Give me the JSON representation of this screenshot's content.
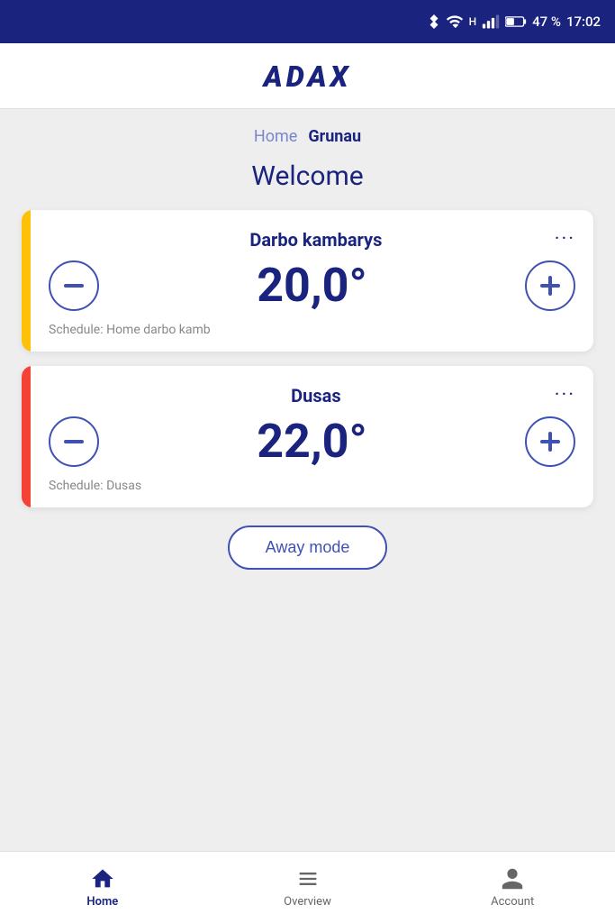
{
  "statusBar": {
    "battery": "47 %",
    "time": "17:02"
  },
  "header": {
    "logo": "ADAX"
  },
  "breadcrumb": {
    "home_label": "Home",
    "location_label": "Grunau"
  },
  "welcome": {
    "text": "Welcome"
  },
  "rooms": [
    {
      "id": "darbo",
      "name": "Darbo kambarys",
      "temperature": "20,0°",
      "schedule": "Schedule: Home darbo kamb",
      "indicator_class": "indicator-yellow"
    },
    {
      "id": "dusas",
      "name": "Dusas",
      "temperature": "22,0°",
      "schedule": "Schedule: Dusas",
      "indicator_class": "indicator-red"
    }
  ],
  "awayMode": {
    "label": "Away mode"
  },
  "bottomNav": {
    "items": [
      {
        "id": "home",
        "label": "Home",
        "active": true
      },
      {
        "id": "overview",
        "label": "Overview",
        "active": false
      },
      {
        "id": "account",
        "label": "Account",
        "active": false
      }
    ]
  }
}
